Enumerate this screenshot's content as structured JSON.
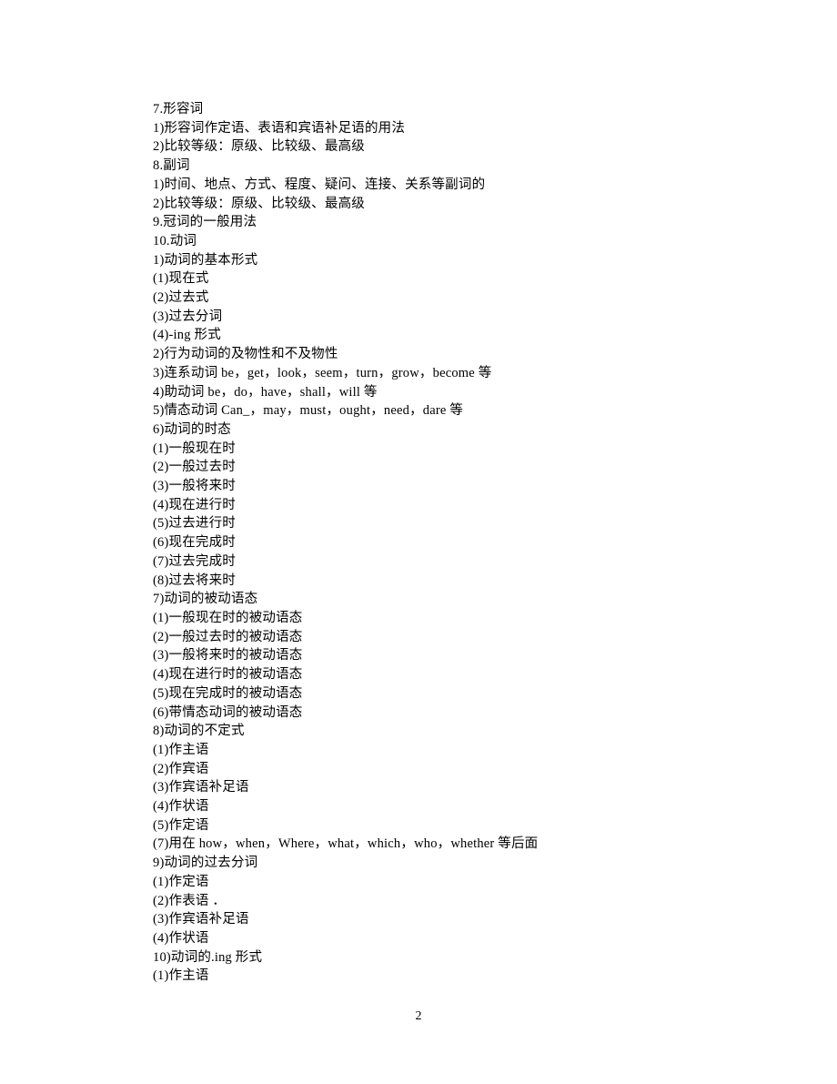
{
  "lines": [
    "7.形容词",
    "1)形容词作定语、表语和宾语补足语的用法",
    "2)比较等级：原级、比较级、最高级",
    "8.副词",
    "1)时间、地点、方式、程度、疑问、连接、关系等副词的",
    "2)比较等级：原级、比较级、最高级",
    "9.冠词的一般用法",
    "10.动词",
    "1)动词的基本形式",
    "(1)现在式",
    "(2)过去式",
    "(3)过去分词",
    "(4)-ing 形式",
    "2)行为动词的及物性和不及物性",
    "3)连系动词 be，get，look，seem，turn，grow，become 等",
    "4)助动词 be，do，have，shall，will 等",
    "5)情态动词 Can_，may，must，ought，need，dare 等",
    "6)动词的时态",
    "(1)一般现在时",
    "(2)一般过去时",
    "(3)一般将来时",
    "(4)现在进行时",
    "(5)过去进行时",
    "(6)现在完成时",
    "(7)过去完成时",
    "(8)过去将来时",
    "7)动词的被动语态",
    "(1)一般现在时的被动语态",
    "(2)一般过去时的被动语态",
    "(3)一般将来时的被动语态",
    "(4)现在进行时的被动语态",
    "(5)现在完成时的被动语态",
    "(6)带情态动词的被动语态",
    "8)动词的不定式",
    "(1)作主语",
    "(2)作宾语",
    "(3)作宾语补足语",
    "(4)作状语",
    "(5)作定语",
    "(7)用在 how，when，Where，what，which，who，whether 等后面",
    "9)动词的过去分词",
    "(1)作定语",
    "(2)作表语  ．",
    "(3)作宾语补足语",
    "(4)作状语",
    "10)动词的.ing 形式",
    "(1)作主语"
  ],
  "page_number": "2"
}
